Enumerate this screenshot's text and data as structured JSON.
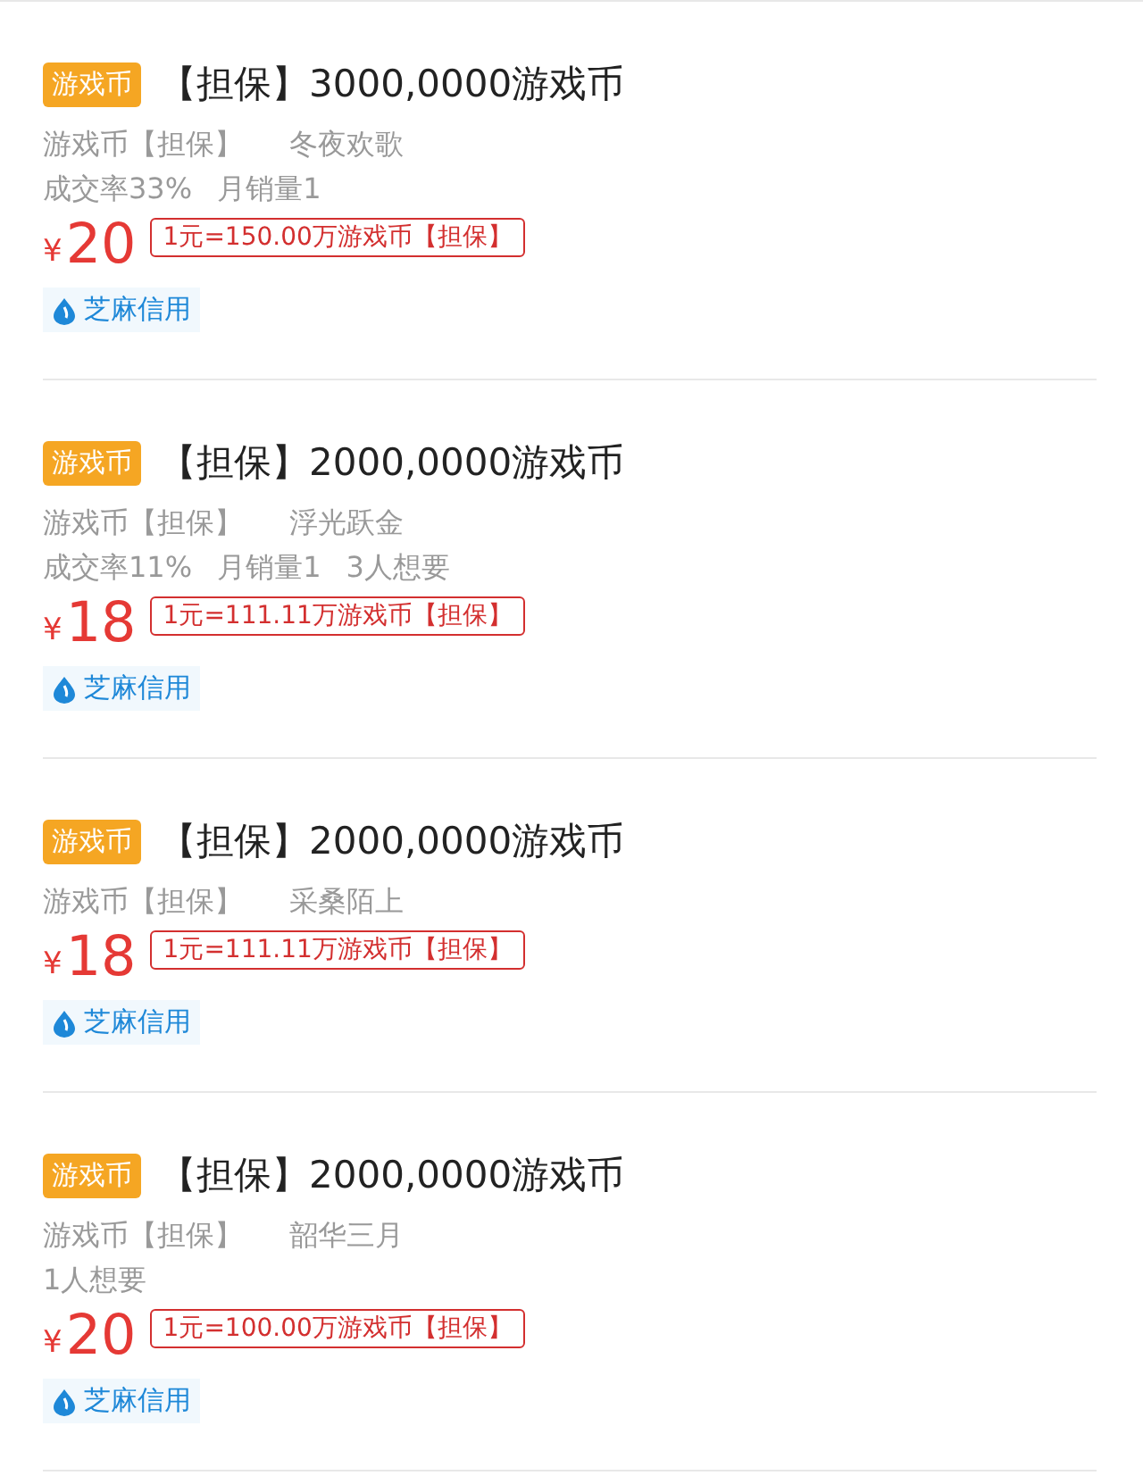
{
  "listings": [
    {
      "tag": "游戏币",
      "title": "【担保】3000,0000游戏币",
      "category": "游戏币【担保】",
      "seller": "冬夜欢歌",
      "stats": [
        "成交率33%",
        "月销量1"
      ],
      "currency": "¥",
      "price": "20",
      "rate": "1元=150.00万游戏币【担保】",
      "credit": "芝麻信用"
    },
    {
      "tag": "游戏币",
      "title": "【担保】2000,0000游戏币",
      "category": "游戏币【担保】",
      "seller": "浮光跃金",
      "stats": [
        "成交率11%",
        "月销量1",
        "3人想要"
      ],
      "currency": "¥",
      "price": "18",
      "rate": "1元=111.11万游戏币【担保】",
      "credit": "芝麻信用"
    },
    {
      "tag": "游戏币",
      "title": "【担保】2000,0000游戏币",
      "category": "游戏币【担保】",
      "seller": "采桑陌上",
      "currency": "¥",
      "price": "18",
      "rate": "1元=111.11万游戏币【担保】",
      "credit": "芝麻信用"
    },
    {
      "tag": "游戏币",
      "title": "【担保】2000,0000游戏币",
      "category": "游戏币【担保】",
      "seller": "韶华三月",
      "stats": [
        "1人想要"
      ],
      "currency": "¥",
      "price": "20",
      "rate": "1元=100.00万游戏币【担保】",
      "credit": "芝麻信用"
    }
  ]
}
